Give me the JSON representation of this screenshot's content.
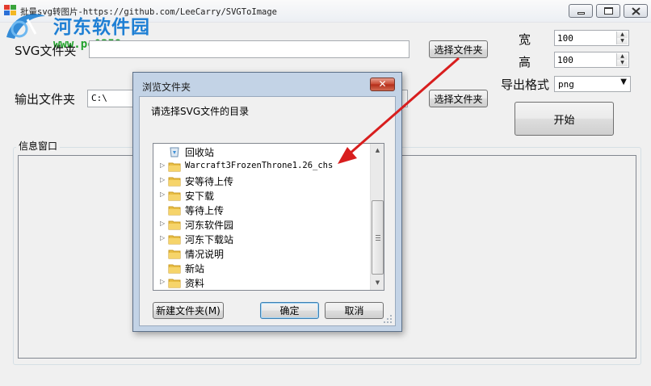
{
  "window": {
    "title": "批量svg转图片-https://github.com/LeeCarry/SVGToImage"
  },
  "watermark": {
    "title": "河东软件园",
    "url": "www.pc0359.cn"
  },
  "form": {
    "svg_folder_label": "SVG文件夹",
    "svg_folder_value": "",
    "select_svg_button": "选择文件夹",
    "output_folder_label": "输出文件夹",
    "output_folder_value": "C:\\",
    "select_output_button": "选择文件夹",
    "width_label": "宽",
    "width_value": "100",
    "height_label": "高",
    "height_value": "100",
    "format_label": "导出格式",
    "format_value": "png",
    "start_button": "开始",
    "info_label": "信息窗口"
  },
  "dialog": {
    "title": "浏览文件夹",
    "prompt": "请选择SVG文件的目录",
    "tree_items": [
      {
        "label": "回收站",
        "icon": "recycle-bin-icon",
        "expandable": false
      },
      {
        "label": "Warcraft3FrozenThrone1.26_chs",
        "icon": "folder-icon",
        "expandable": true
      },
      {
        "label": "安等待上传",
        "icon": "folder-icon",
        "expandable": true
      },
      {
        "label": "安下载",
        "icon": "folder-icon",
        "expandable": true
      },
      {
        "label": "等待上传",
        "icon": "folder-icon",
        "expandable": false
      },
      {
        "label": "河东软件园",
        "icon": "folder-icon",
        "expandable": true
      },
      {
        "label": "河东下载站",
        "icon": "folder-icon",
        "expandable": true
      },
      {
        "label": "情况说明",
        "icon": "folder-icon",
        "expandable": false
      },
      {
        "label": "新站",
        "icon": "folder-icon",
        "expandable": false
      },
      {
        "label": "资料",
        "icon": "folder-icon",
        "expandable": true
      }
    ],
    "new_folder_button": "新建文件夹(M)",
    "ok_button": "确定",
    "cancel_button": "取消"
  },
  "colors": {
    "watermark_blue": "#1e7fd4",
    "watermark_green": "#22a22c",
    "arrow_red": "#d81e1e",
    "dialog_frame": "#c3d3e6",
    "close_red": "#c8462f"
  }
}
